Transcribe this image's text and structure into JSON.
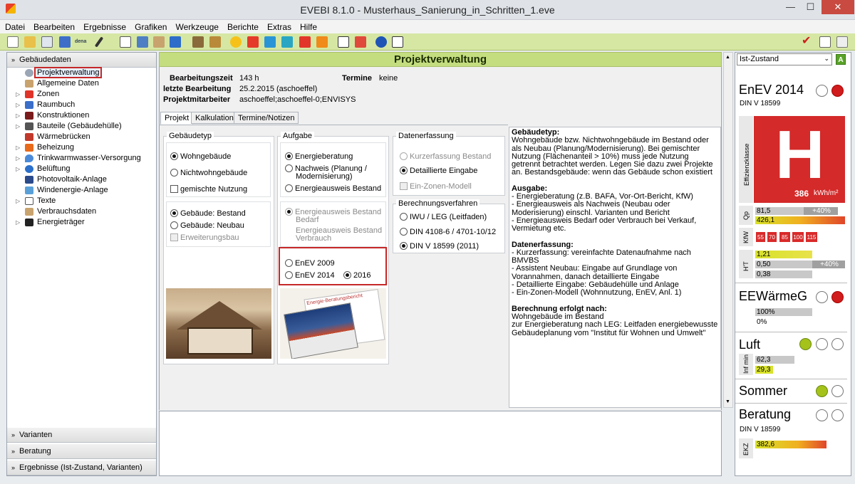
{
  "window": {
    "title": "EVEBI 8.1.0 - Musterhaus_Sanierung_in_Schritten_1.eve",
    "min": "—",
    "max": "☐",
    "close": "✕"
  },
  "menu": [
    "Datei",
    "Bearbeiten",
    "Ergebnisse",
    "Grafiken",
    "Werkzeuge",
    "Berichte",
    "Extras",
    "Hilfe"
  ],
  "toolbar": {
    "dena": "dena"
  },
  "left": {
    "section_top": "Gebäudedaten",
    "tree": [
      "Projektverwaltung",
      "Allgemeine Daten",
      "Zonen",
      "Raumbuch",
      "Konstruktionen",
      "Bauteile (Gebäudehülle)",
      "Wärmebrücken",
      "Beheizung",
      "Trinkwarmwasser-Versorgung",
      "Belüftung",
      "Photovoltaik-Anlage",
      "Windenergie-Anlage",
      "Texte",
      "Verbrauchsdaten",
      "Energieträger"
    ],
    "sections_bottom": [
      "Varianten",
      "Beratung",
      "Ergebnisse (Ist-Zustand, Varianten)"
    ]
  },
  "main": {
    "header": "Projektverwaltung",
    "bearbeitungszeit_label": "Bearbeitungszeit",
    "bearbeitungszeit": "143 h",
    "letzte_label": "letzte Bearbeitung",
    "letzte": "25.2.2015 (aschoeffel)",
    "mitarbeiter_label": "Projektmitarbeiter",
    "mitarbeiter": "aschoeffel;aschoeffel-0;ENVISYS",
    "termine_label": "Termine",
    "termine": "keine",
    "tabs": [
      "Projekt",
      "Kalkulation",
      "Termine/Notizen"
    ],
    "gebaeudetyp": {
      "title": "Gebäudetyp",
      "wohn": "Wohngebäude",
      "nichtwohn": "Nichtwohngebäude",
      "gemischt": "gemischte Nutzung",
      "bestand": "Gebäude: Bestand",
      "neubau": "Gebäude: Neubau",
      "erweiterung": "Erweiterungsbau"
    },
    "aufgabe": {
      "title": "Aufgabe",
      "beratung": "Energieberatung",
      "nachweis": "Nachweis (Planung / Modernisierung)",
      "ausweis": "Energieausweis Bestand",
      "bedarf": "Energieausweis Bestand Bedarf",
      "verbrauch": "Energieausweis Bestand Verbrauch",
      "enev2009": "EnEV 2009",
      "enev2014": "EnEV 2014",
      "y2016": "2016"
    },
    "datenerfassung": {
      "title": "Datenerfassung",
      "kurz": "Kurzerfassung Bestand",
      "detail": "Detaillierte Eingabe",
      "einzonen": "Ein-Zonen-Modell"
    },
    "berechnung": {
      "title": "Berechnungsverfahren",
      "iwu": "IWU / LEG (Leitfaden)",
      "din4108": "DIN 4108-6 / 4701-10/12",
      "din18599": "DIN V 18599 (2011)"
    },
    "brochure_text": "Energie-Beratungsbericht",
    "info": {
      "h1": "Gebäudetyp:",
      "t1": "Wohngebäude bzw. Nichtwohngebäude im Bestand oder als Neubau (Planung/Modernisierung). Bei gemischter Nutzung (Flächenanteil > 10%) muss jede Nutzung getrennt betrachtet werden. Legen Sie dazu zwei Projekte an. Bestandsgebäude: wenn das Gebäude schon existiert",
      "h2": "Ausgabe:",
      "t2a": "- Energieberatung (z.B. BAFA, Vor-Ort-Bericht, KfW)",
      "t2b": "- Energieausweis als Nachweis (Neubau oder Moderisierung) einschl. Varianten und Bericht",
      "t2c": "- Energieausweis Bedarf oder Verbrauch bei Verkauf, Vermietung etc.",
      "h3": "Datenerfassung:",
      "t3a": "- Kurzerfassung: vereinfachte Datenaufnahme nach BMVBS",
      "t3b": "- Assistent Neubau: Eingabe auf Grundlage von Vorannahmen, danach detaillierte Eingabe",
      "t3c": "- Detaillierte Eingabe: Gebäudehülle und Anlage",
      "t3d": "- Ein-Zonen-Modell (Wohnnutzung, EnEV, Anl. 1)",
      "h4": "Berechnung erfolgt nach:",
      "t4a": "Wohngebäude im Bestand",
      "t4b": "zur Energieberatung nach LEG: Leitfaden energiebewusste Gebäudeplanung vom \"Institut für Wohnen und Umwelt\""
    }
  },
  "right": {
    "select": "Ist-Zustand",
    "badge": "A",
    "enev": "EnEV 2014",
    "din": "DIN V 18599",
    "effizienz_label": "Effizienzklasse",
    "klasse": "H",
    "kwh": "386",
    "kwh_unit": "kWh/m²",
    "qp_label": "Qp",
    "qp1": "81,5",
    "qp_pct": "+40%",
    "qp2": "426,1",
    "kfw_label": "KfW",
    "kfw": [
      "55",
      "70",
      "85",
      "100",
      "115"
    ],
    "ht_label": "H'T",
    "ht1": "1,21",
    "ht2": "0,50",
    "ht_pct": "+40%",
    "ht3": "0,38",
    "eew": "EEWärmeG",
    "eew1": "100%",
    "eew2": "0%",
    "luft": "Luft",
    "inf_label": "Inf min",
    "luft1": "62,3",
    "luft2": "29,3",
    "sommer": "Sommer",
    "beratung": "Beratung",
    "beratung_din": "DIN V 18599",
    "ekz_label": "EKZ",
    "ekz": "382,6"
  }
}
